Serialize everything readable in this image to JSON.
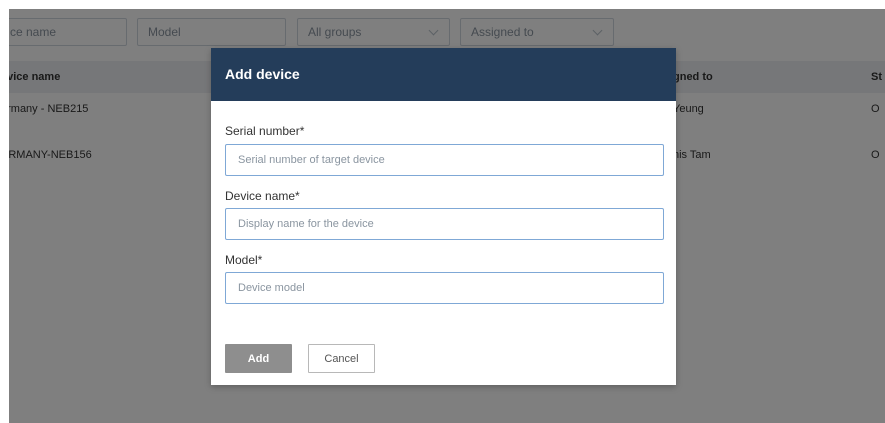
{
  "filters": {
    "device_name_placeholder": "ce name",
    "model_placeholder": "Model",
    "groups_value": "All groups",
    "assigned_value": "Assigned to"
  },
  "table": {
    "headers": {
      "device_name": "evice name",
      "assigned_to": "gned to",
      "status": "St"
    },
    "rows": [
      {
        "device_name": "ermany - NEB215",
        "assigned_to": "Yeung",
        "status": "O"
      },
      {
        "device_name": "ERMANY-NEB156",
        "assigned_to": "nis Tam",
        "status": "O"
      }
    ]
  },
  "modal": {
    "title": "Add device",
    "fields": {
      "serial": {
        "label": "Serial number*",
        "placeholder": "Serial number of target device"
      },
      "name": {
        "label": "Device name*",
        "placeholder": "Display name for the device"
      },
      "model": {
        "label": "Model*",
        "placeholder": "Device model"
      }
    },
    "buttons": {
      "add": "Add",
      "cancel": "Cancel"
    }
  },
  "colors": {
    "modal_header": "#243d5a",
    "add_button": "#8e8e8e",
    "input_border": "#7fa8d6",
    "table_header_bg": "#eceff2"
  }
}
